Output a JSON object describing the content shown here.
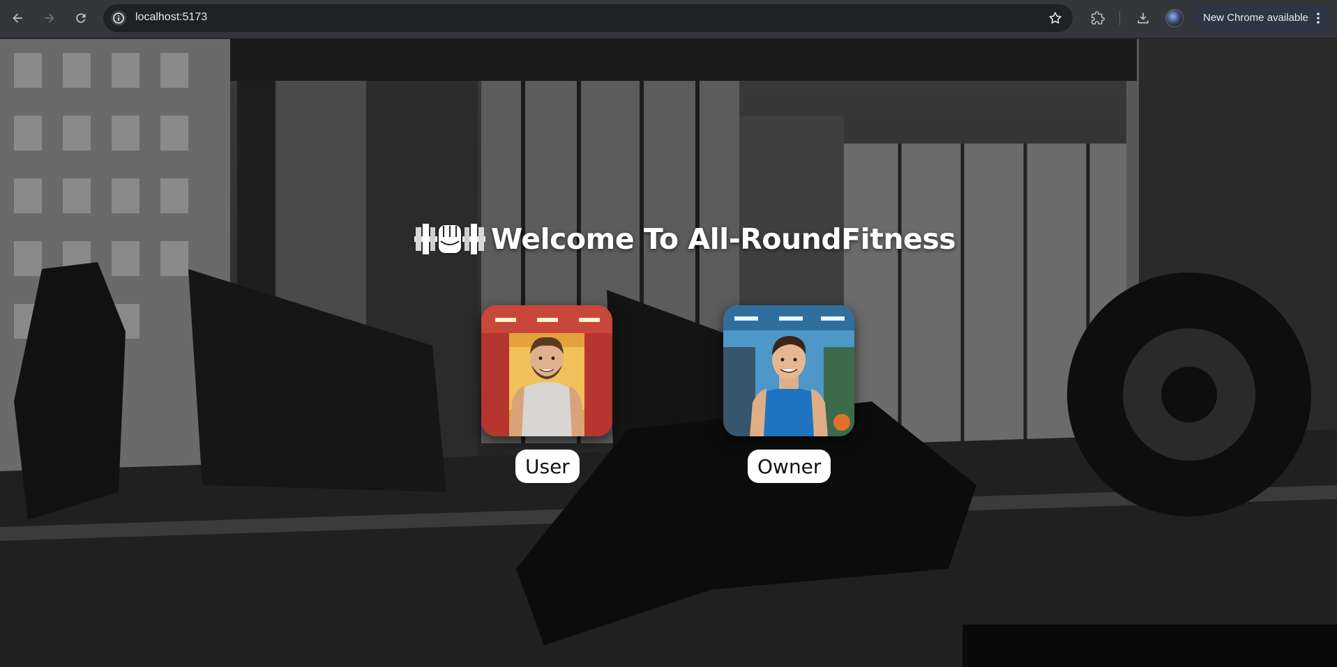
{
  "browser": {
    "url": "localhost:5173",
    "update_label": "New Chrome available",
    "icons": [
      "back-icon",
      "forward-icon",
      "reload-icon",
      "site-info-icon",
      "bookmark-star-icon",
      "extensions-icon",
      "downloads-icon",
      "profile-avatar",
      "more-menu-icon"
    ]
  },
  "page": {
    "title": "Welcome To All-RoundFitness",
    "logo": "flexed-fist-dumbbell-logo",
    "roles": [
      {
        "label": "User",
        "image": "user-avatar-cartoon"
      },
      {
        "label": "Owner",
        "image": "owner-avatar-cartoon"
      }
    ]
  },
  "colors": {
    "chrome_toolbar": "#35363a",
    "omnibox": "#202124",
    "update_pill": "#2d3546",
    "title_text": "#ffffff",
    "role_button_bg": "#ffffff"
  }
}
